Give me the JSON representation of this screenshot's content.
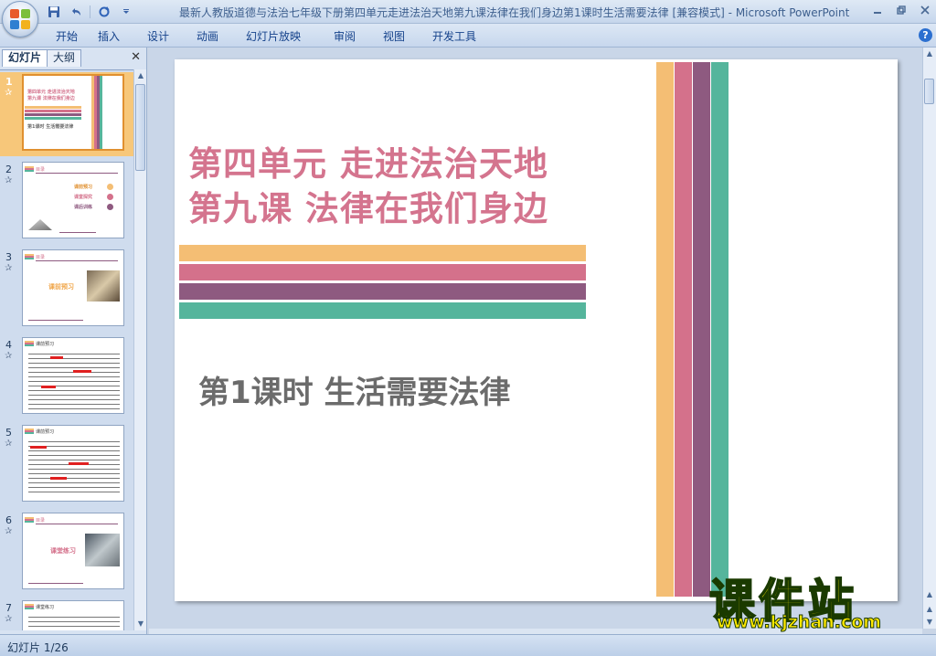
{
  "window": {
    "title": "最新人教版道德与法治七年级下册第四单元走进法治天地第九课法律在我们身边第1课时生活需要法律 [兼容模式]",
    "app_name": "Microsoft PowerPoint",
    "separator": "-"
  },
  "qat": {
    "save_icon": "save-icon",
    "undo_icon": "undo-icon",
    "redo_icon": "redo-icon",
    "customize_icon": "chevron-down-icon"
  },
  "ribbon": {
    "tabs": [
      "开始",
      "插入",
      "设计",
      "动画",
      "幻灯片放映",
      "审阅",
      "视图",
      "开发工具"
    ]
  },
  "panel": {
    "tab_slides": "幻灯片",
    "tab_outline": "大纲",
    "close": "✕"
  },
  "thumbnails": [
    {
      "num": "1",
      "star": "✰",
      "selected": true
    },
    {
      "num": "2",
      "star": "✰",
      "selected": false
    },
    {
      "num": "3",
      "star": "✰",
      "selected": false
    },
    {
      "num": "4",
      "star": "✰",
      "selected": false
    },
    {
      "num": "5",
      "star": "✰",
      "selected": false
    },
    {
      "num": "6",
      "star": "✰",
      "selected": false
    },
    {
      "num": "7",
      "star": "✰",
      "selected": false
    }
  ],
  "thumb_text": {
    "s1_line1": "第四单元  走进法治天地",
    "s1_line2": "第九课    法律在我们身边",
    "s1_sub": "第1课时  生活需要法律",
    "s2_item1": "课前预习",
    "s2_item2": "课堂探究",
    "s2_item3": "课后训练",
    "s3_label": "课前预习",
    "s6_label": "课堂练习",
    "contents": "目录",
    "s4_head": "课前预习",
    "s5_head": "课前预习",
    "s7_head": "课堂练习"
  },
  "slide": {
    "title_line1": "第四单元  走进法治天地",
    "title_line2": "第九课    法律在我们身边",
    "subtitle": "第1课时  生活需要法律",
    "colors": {
      "orange": "#f4be74",
      "pink": "#d4718b",
      "purple": "#8e5a80",
      "teal": "#55b59c"
    }
  },
  "watermark": {
    "cn": "课件站",
    "url": "www.kjzhan.com"
  },
  "status": {
    "slide_info": "幻灯片 1/26"
  }
}
